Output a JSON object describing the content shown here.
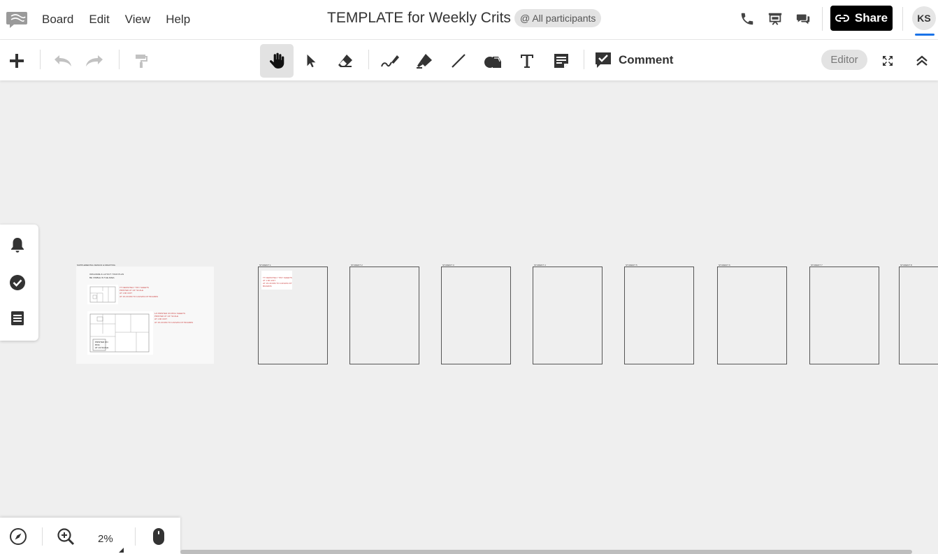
{
  "header": {
    "menu": [
      "Board",
      "Edit",
      "View",
      "Help"
    ],
    "title": "TEMPLATE for Weekly Crits",
    "participants": "@ All participants",
    "share_label": "Share",
    "avatar_initials": "KS"
  },
  "toolbar": {
    "comment_label": "Comment",
    "editor_label": "Editor"
  },
  "canvas": {
    "template_card": {
      "heading": "SUPPLEMENTAL DESIGN & DRAFTING",
      "subtitle_1": "ORGANIZE & LAYOUT YOUR PLAN",
      "subtitle_2": "BE VISIBLE IN THE AREA",
      "note_a": [
        "TT DEFINITELY TINY SHEETS",
        "PRINTED AT 1/4\" SCALE",
        "AT 1:96 UNIT",
        "AT 1% ZOOM TO CANVAS FIT BOARDS"
      ],
      "note_b": [
        "1/4 PRINTED ON 8X11 SHEETS",
        "PRINTED AT 1/4\" SCALE",
        "AT 1:96 UNIT",
        "AT 1% ZOOM TO CANVAS FIT BOARDS"
      ],
      "plan_label": [
        "PRINTED ON",
        "8X11",
        "AT 1/4 SCALE"
      ]
    },
    "frames": [
      {
        "label": "STUDENT 1",
        "note": [
          "TT DEFINITELY TINY SHEETS",
          "AT 1:96 UNIT",
          "AT 1% ZOOM TO CANVAS FIT BOARDS"
        ]
      },
      {
        "label": "STUDENT 2"
      },
      {
        "label": "STUDENT 3"
      },
      {
        "label": "STUDENT 4"
      },
      {
        "label": "STUDENT 5"
      },
      {
        "label": "STUDENT 6"
      },
      {
        "label": "STUDENT 7"
      },
      {
        "label": "STUDENT 8"
      }
    ]
  },
  "bottom": {
    "zoom": "2%"
  }
}
